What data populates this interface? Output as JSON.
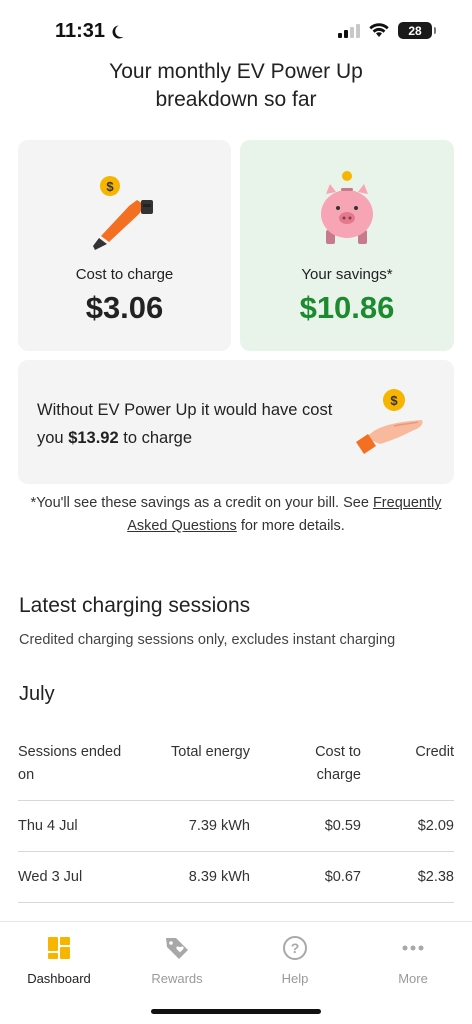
{
  "status_bar": {
    "time": "11:31",
    "battery": "28"
  },
  "header": {
    "title_line1": "Your monthly EV Power Up",
    "title_line2": "breakdown so far"
  },
  "cards": {
    "cost_label": "Cost to charge",
    "cost_value": "$3.06",
    "savings_label": "Your savings*",
    "savings_value": "$10.86",
    "without_text_1": "Without EV Power Up it would have cost you ",
    "without_amount": "$13.92",
    "without_text_2": " to charge"
  },
  "footnote": {
    "text_1": "*You'll see these savings as a credit on your bill. See ",
    "link": "Frequently Asked Questions",
    "text_2": " for more details."
  },
  "sessions": {
    "title": "Latest charging sessions",
    "subtitle": "Credited charging sessions only, excludes instant charging",
    "month": "July",
    "headers": [
      "Sessions ended on",
      "Total energy",
      "Cost to charge",
      "Credit"
    ],
    "rows": [
      {
        "date": "Thu 4 Jul",
        "energy": "7.39 kWh",
        "cost": "$0.59",
        "credit": "$2.09"
      },
      {
        "date": "Wed 3 Jul",
        "energy": "8.39 kWh",
        "cost": "$0.67",
        "credit": "$2.38"
      }
    ]
  },
  "nav": [
    {
      "label": "Dashboard",
      "icon": "dashboard-icon",
      "active": true
    },
    {
      "label": "Rewards",
      "icon": "rewards-tag-icon",
      "active": false
    },
    {
      "label": "Help",
      "icon": "help-icon",
      "active": false
    },
    {
      "label": "More",
      "icon": "more-icon",
      "active": false
    }
  ],
  "colors": {
    "accent_orange": "#f36f21",
    "savings_green": "#1c8a2e",
    "coin_yellow": "#f7b500"
  }
}
